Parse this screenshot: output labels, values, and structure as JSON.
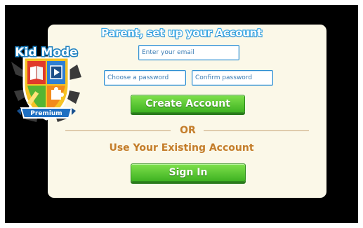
{
  "form": {
    "title": "Parent, set up your Account",
    "email_placeholder": "Enter your email",
    "password_placeholder": "Choose a password",
    "confirm_placeholder": "Confirm password",
    "create_button": "Create Account",
    "or_text": "OR",
    "existing_text": "Use Your Existing Account",
    "sign_in_button": "Sign In"
  },
  "badge": {
    "name": "Kid Mode",
    "trademark": "™",
    "tier": "Premium",
    "icons": [
      "book-icon",
      "video-icon",
      "pencil-icon",
      "puzzle-icon"
    ]
  },
  "colors": {
    "background": "#000000",
    "card": "#fbf8e8",
    "accent_blue": "#35a6e6",
    "button_green": "#4cc12c",
    "text_orange": "#c47d2a"
  }
}
